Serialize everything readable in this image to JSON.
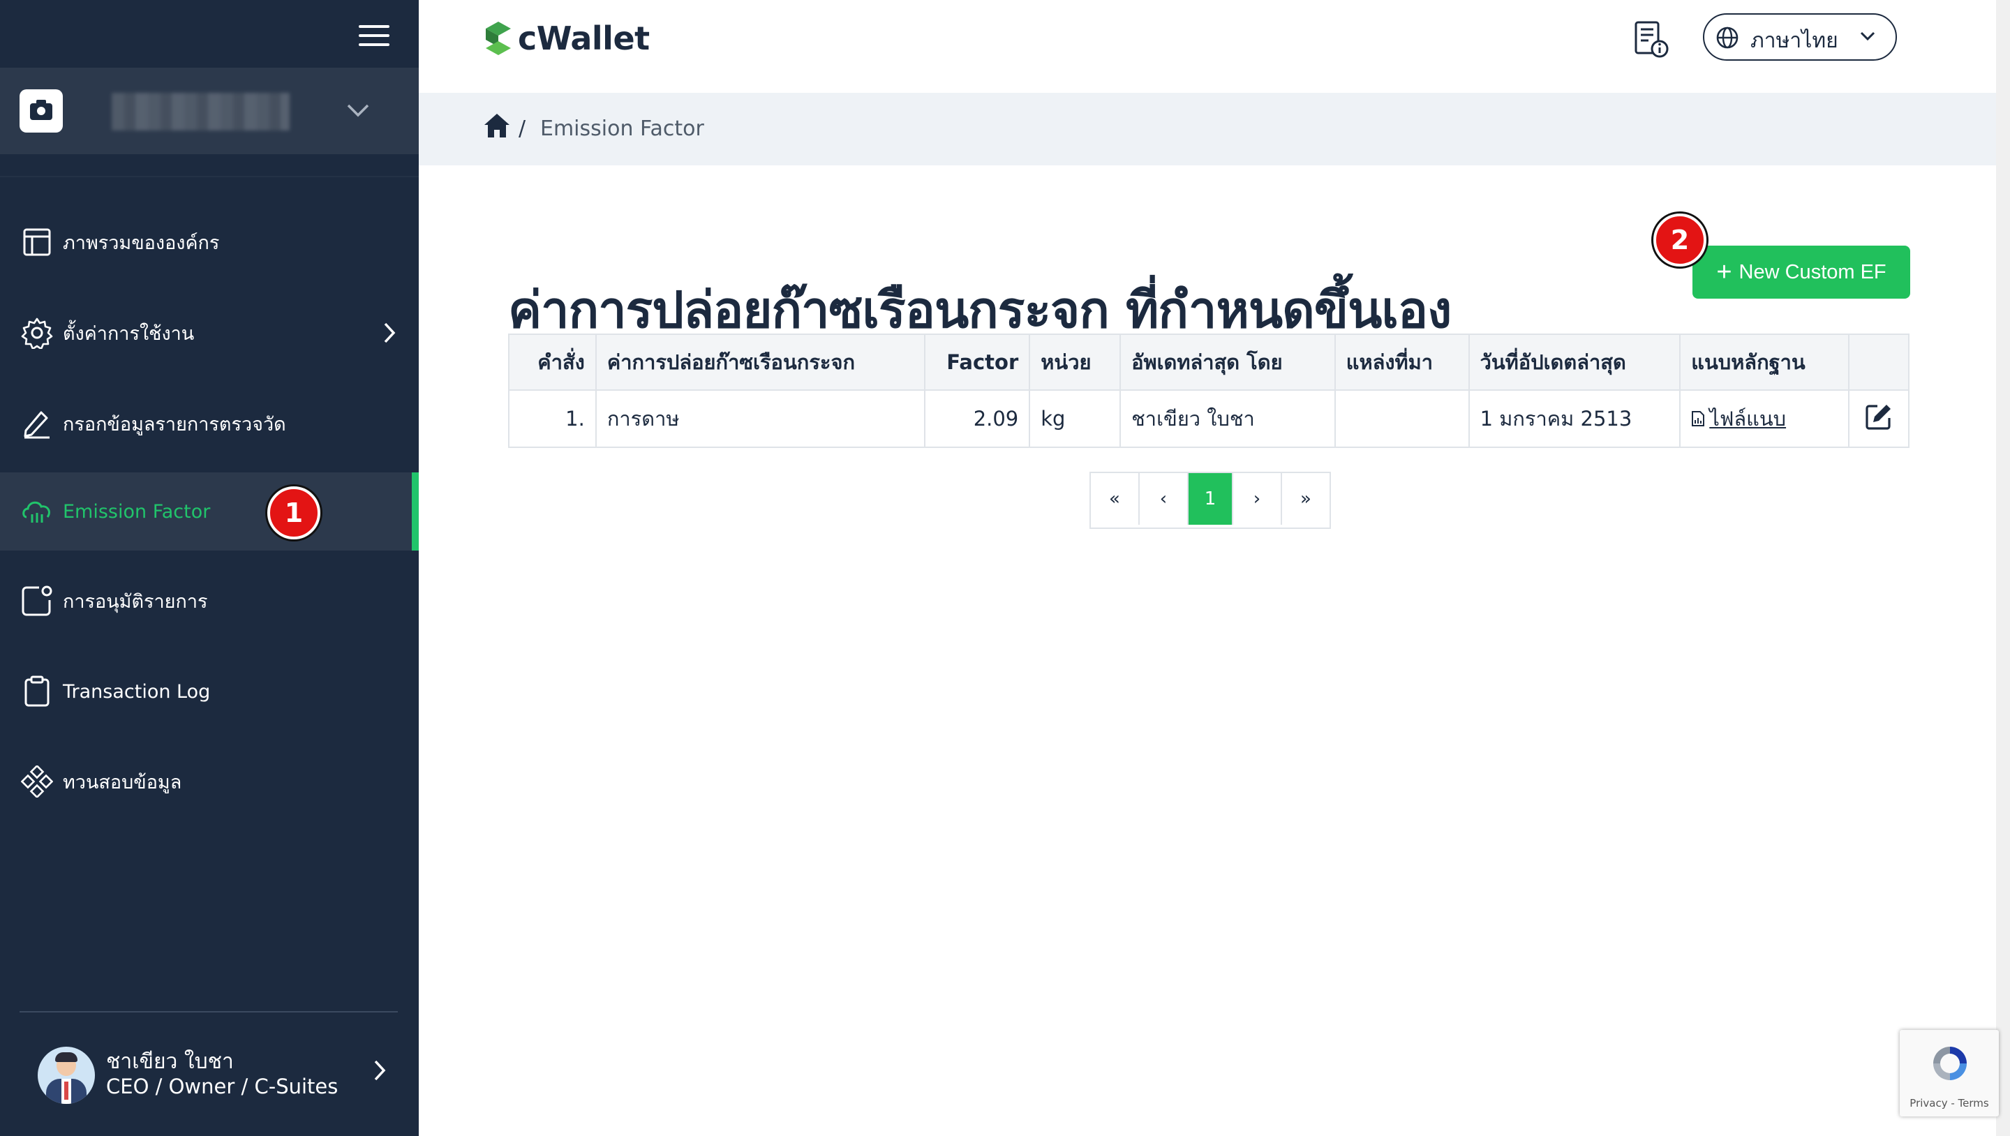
{
  "sidebar": {
    "menu": [
      {
        "label": "ภาพรวมขององค์กร",
        "icon": "layout-icon"
      },
      {
        "label": "ตั้งค่าการใช้งาน",
        "icon": "gear-icon"
      },
      {
        "label": "กรอกข้อมูลรายการตรวจวัด",
        "icon": "pencil-icon"
      },
      {
        "label": "Emission Factor",
        "icon": "cloud-icon"
      },
      {
        "label": "การอนุมัติรายการ",
        "icon": "approval-icon"
      },
      {
        "label": "Transaction Log",
        "icon": "clipboard-icon"
      },
      {
        "label": "ทวนสอบข้อมูล",
        "icon": "diamonds-icon"
      }
    ],
    "user": {
      "name": "ชาเขียว ใบชา",
      "role": "CEO / Owner / C-Suites"
    }
  },
  "header": {
    "logo_text": "cWallet",
    "language": "ภาษาไทย"
  },
  "breadcrumb": {
    "separator": "/",
    "current": "Emission Factor"
  },
  "page": {
    "title": "ค่าการปล่อยก๊าซเรือนกระจก ที่กำหนดขึ้นเอง",
    "new_button": "New Custom EF"
  },
  "table": {
    "headers": [
      "คำสั่ง",
      "ค่าการปล่อยก๊าซเรือนกระจก",
      "Factor",
      "หน่วย",
      "อัพเดทล่าสุด โดย",
      "แหล่งที่มา",
      "วันที่อัปเดตล่าสุด",
      "แนบหลักฐาน",
      ""
    ],
    "rows": [
      {
        "order": "1.",
        "name": "การดาษ",
        "factor": "2.09",
        "unit": "kg",
        "updated_by": "ชาเขียว ใบชา",
        "source": "",
        "updated_date": "1 มกราคม 2513",
        "attachment": "ไฟล์แนบ"
      }
    ]
  },
  "pagination": {
    "first": "«",
    "prev": "‹",
    "current": "1",
    "next": "›",
    "last": "»"
  },
  "markers": {
    "m1": "1",
    "m2": "2"
  },
  "recaptcha": {
    "text": "Privacy - Terms"
  },
  "colors": {
    "sidebar_bg": "#1c2a3f",
    "accent_green": "#21c05c",
    "marker_red": "#e31414"
  }
}
